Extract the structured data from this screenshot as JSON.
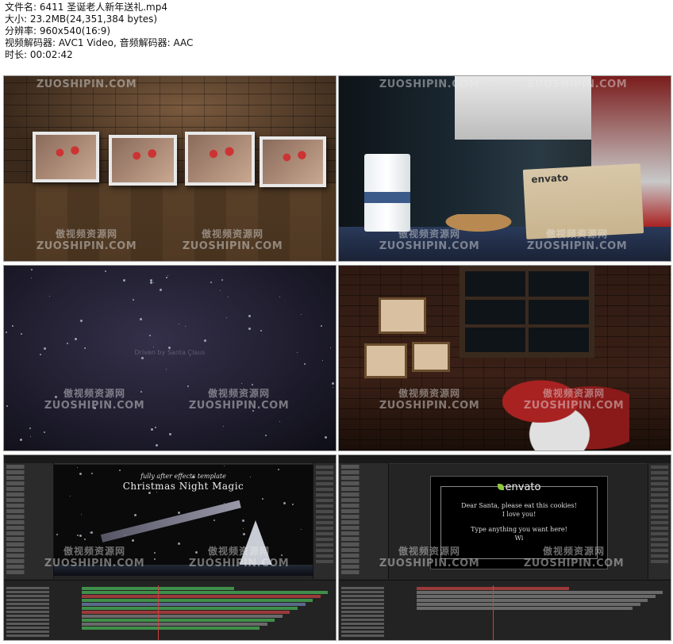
{
  "file_info": {
    "filename": "文件名: 6411 圣诞老人新年送礼.mp4",
    "size": "大小: 23.2MB(24,351,384 bytes)",
    "resolution": "分辨率: 960x540(16:9)",
    "codec": "视频解码器: AVC1 Video, 音频解码器: AAC",
    "duration": "时长: 00:02:42"
  },
  "watermark": {
    "cn": "傲视频资源网",
    "en": "ZUOSHIPIN.COM"
  },
  "frame2": {
    "card_logo": "envato"
  },
  "frame3": {
    "faint_text": "Driven by Santa Claus"
  },
  "frame5": {
    "subtitle": "fully after effects template",
    "title": "Christmas Night Magic"
  },
  "frame6": {
    "logo": "envato",
    "line1": "Dear Santa, please eat this cookies!",
    "line2": "I love you!",
    "line3": "Type anything you want here!",
    "line4": "Wi"
  },
  "colors": {
    "envato_leaf": "#8dc63f",
    "timeline_green": "#3f8f4a",
    "timeline_red": "#9a3a3a",
    "playhead": "#d04040"
  }
}
